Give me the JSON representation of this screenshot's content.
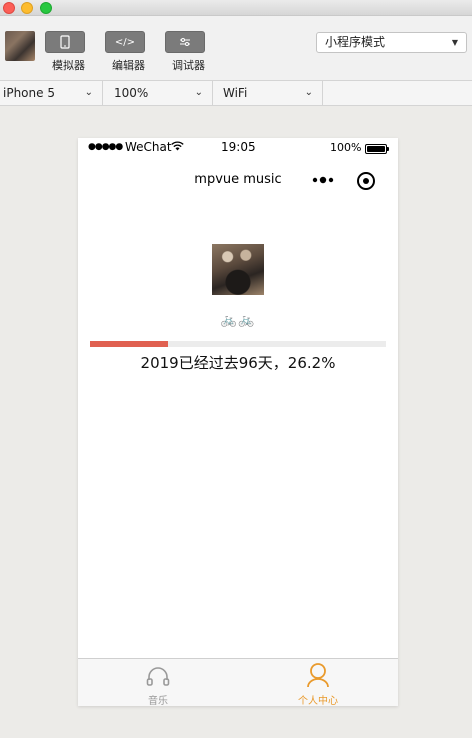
{
  "toolbar": {
    "simulator_label": "模拟器",
    "editor_label": "编辑器",
    "debugger_label": "调试器",
    "editor_icon_text": "</>",
    "mode_select": "小程序模式"
  },
  "devicebar": {
    "device": "iPhone 5",
    "zoom": "100%",
    "network": "WiFi"
  },
  "statusbar": {
    "signal": "●●●●●",
    "carrier": "WeChat",
    "time": "19:05",
    "battery": "100%"
  },
  "navbar": {
    "title": "mpvue music"
  },
  "main": {
    "bikes": "🚲🚲",
    "year_text": "2019已经过去96天，26.2%",
    "progress_percent": 26.2,
    "progress_color": "#e06050"
  },
  "tabbar": {
    "tabs": [
      {
        "label": "音乐",
        "icon": "headphones-icon",
        "active": false
      },
      {
        "label": "个人中心",
        "icon": "person-icon",
        "active": true
      }
    ],
    "active_color": "#e99a2c",
    "inactive_color": "#999999"
  }
}
